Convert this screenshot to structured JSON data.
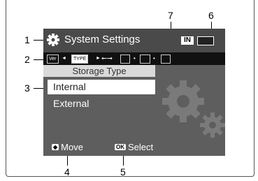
{
  "callouts": [
    "1",
    "2",
    "3",
    "4",
    "5",
    "6",
    "7"
  ],
  "title": "System Settings",
  "storage_indicator": "IN",
  "tabs": [
    "Ver",
    "TYPE"
  ],
  "header": "Storage Type",
  "menu": [
    "Internal",
    "External"
  ],
  "footer": {
    "move_label": "Move",
    "select_icon": "OK",
    "select_label": "Select"
  },
  "colors": {
    "screen": "#5e5e5e",
    "selected": "#ffffff",
    "header": "#d9d9d9"
  }
}
